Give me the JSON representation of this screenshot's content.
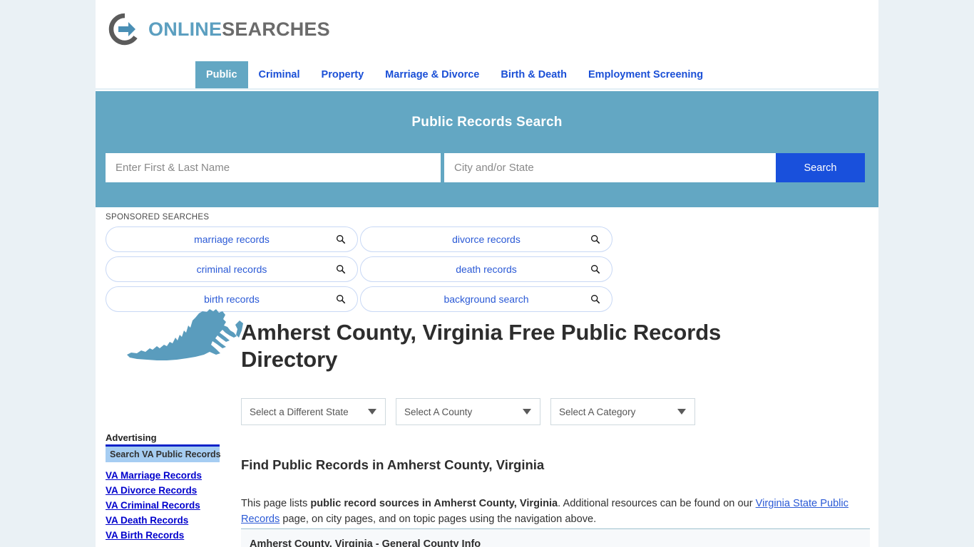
{
  "brand": {
    "name_part1": "ONLINE",
    "name_part2": "SEARCHES",
    "logo_icon": "circle-arrow-icon",
    "accent_blue": "#5c9fc0",
    "accent_gray": "#6b6b6b"
  },
  "nav": {
    "items": [
      {
        "label": "Public",
        "active": true
      },
      {
        "label": "Criminal",
        "active": false
      },
      {
        "label": "Property",
        "active": false
      },
      {
        "label": "Marriage & Divorce",
        "active": false
      },
      {
        "label": "Birth & Death",
        "active": false
      },
      {
        "label": "Employment Screening",
        "active": false
      }
    ],
    "active_bg": "#63a7c3",
    "link_color": "#1a4fd6"
  },
  "hero": {
    "title": "Public Records Search",
    "background": "#63a7c3",
    "name_placeholder": "Enter First & Last Name",
    "name_value": "",
    "city_placeholder": "City and/or State",
    "city_value": "",
    "search_label": "Search",
    "search_button_color": "#1950dc"
  },
  "sponsored": {
    "label": "SPONSORED SEARCHES",
    "pills": [
      {
        "label": "marriage records"
      },
      {
        "label": "divorce records"
      },
      {
        "label": "criminal records"
      },
      {
        "label": "death records"
      },
      {
        "label": "birth records"
      },
      {
        "label": "background search"
      }
    ]
  },
  "page": {
    "state_map_alt": "virginia-state-map",
    "title": "Amherst County, Virginia Free Public Records Directory"
  },
  "selects": [
    {
      "label": "Select a Different State"
    },
    {
      "label": "Select A County"
    },
    {
      "label": "Select A Category"
    }
  ],
  "sidebar_ad": {
    "heading": "Advertising",
    "bar_label": "Search VA Public Records",
    "bar_color": "#a6cdf2",
    "rule_color": "#0a22c9",
    "links": [
      {
        "label": "VA Marriage Records"
      },
      {
        "label": "VA Divorce Records"
      },
      {
        "label": "VA Criminal Records"
      },
      {
        "label": "VA Death Records"
      },
      {
        "label": "VA Birth Records"
      }
    ]
  },
  "main": {
    "heading": "Find Public Records in Amherst County, Virginia",
    "para_lead": "This page lists ",
    "para_bold": "public record sources in Amherst County, Virginia",
    "para_mid": ". Additional resources can be found on our ",
    "para_link": "Virginia State Public Records",
    "para_tail": " page, on city pages, and on topic pages using the navigation above.",
    "section_row_label": "Amherst County, Virginia - General County Info"
  }
}
